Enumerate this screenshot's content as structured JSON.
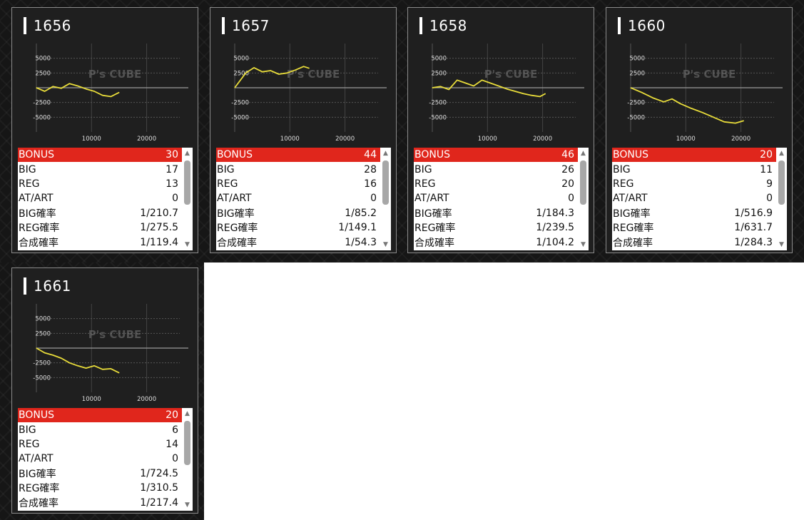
{
  "theme": {
    "highlight": "#e0261c",
    "line": "#e8dc3a",
    "panel": "#1f1f1f"
  },
  "watermark": "P's CUBE",
  "machines": [
    {
      "id": "1656",
      "chart_data": {
        "type": "line",
        "x": [
          0,
          1500,
          3000,
          4500,
          6000,
          7500,
          9000,
          10500,
          12000,
          13500,
          15000
        ],
        "y": [
          0,
          -600,
          200,
          -100,
          700,
          300,
          -200,
          -600,
          -1300,
          -1500,
          -800
        ],
        "xticks": [
          "10000",
          "20000"
        ],
        "yticks": [
          "5000",
          "2500",
          "-2500",
          "-5000"
        ],
        "xlim": [
          0,
          26000
        ],
        "ylim": [
          -7500,
          7500
        ]
      },
      "stats": [
        {
          "label": "BONUS",
          "value": "30"
        },
        {
          "label": "BIG",
          "value": "17"
        },
        {
          "label": "REG",
          "value": "13"
        },
        {
          "label": "AT/ART",
          "value": "0"
        },
        {
          "label": "BIG確率",
          "value": "1/210.7"
        },
        {
          "label": "REG確率",
          "value": "1/275.5"
        },
        {
          "label": "合成確率",
          "value": "1/119.4"
        }
      ]
    },
    {
      "id": "1657",
      "chart_data": {
        "type": "line",
        "x": [
          0,
          2000,
          3500,
          5000,
          6500,
          8000,
          9500,
          11000,
          12500,
          13500
        ],
        "y": [
          0,
          2500,
          3400,
          2700,
          2900,
          2300,
          2500,
          3000,
          3600,
          3300
        ],
        "xticks": [
          "10000",
          "20000"
        ],
        "yticks": [
          "5000",
          "2500",
          "-2500",
          "-5000"
        ],
        "xlim": [
          0,
          26000
        ],
        "ylim": [
          -7500,
          7500
        ]
      },
      "stats": [
        {
          "label": "BONUS",
          "value": "44"
        },
        {
          "label": "BIG",
          "value": "28"
        },
        {
          "label": "REG",
          "value": "16"
        },
        {
          "label": "AT/ART",
          "value": "0"
        },
        {
          "label": "BIG確率",
          "value": "1/85.2"
        },
        {
          "label": "REG確率",
          "value": "1/149.1"
        },
        {
          "label": "合成確率",
          "value": "1/54.3"
        }
      ]
    },
    {
      "id": "1658",
      "chart_data": {
        "type": "line",
        "x": [
          0,
          1500,
          3000,
          4500,
          6000,
          7500,
          9000,
          10500,
          12000,
          13500,
          15000,
          16500,
          18000,
          19500,
          20500
        ],
        "y": [
          0,
          200,
          -300,
          1300,
          800,
          300,
          1300,
          800,
          300,
          -200,
          -600,
          -1000,
          -1300,
          -1500,
          -1000
        ],
        "xticks": [
          "10000",
          "20000"
        ],
        "yticks": [
          "5000",
          "2500",
          "-2500",
          "-5000"
        ],
        "xlim": [
          0,
          26000
        ],
        "ylim": [
          -7500,
          7500
        ]
      },
      "stats": [
        {
          "label": "BONUS",
          "value": "46"
        },
        {
          "label": "BIG",
          "value": "26"
        },
        {
          "label": "REG",
          "value": "20"
        },
        {
          "label": "AT/ART",
          "value": "0"
        },
        {
          "label": "BIG確率",
          "value": "1/184.3"
        },
        {
          "label": "REG確率",
          "value": "1/239.5"
        },
        {
          "label": "合成確率",
          "value": "1/104.2"
        }
      ]
    },
    {
      "id": "1660",
      "chart_data": {
        "type": "line",
        "x": [
          0,
          2000,
          4000,
          6000,
          7500,
          9000,
          11000,
          13000,
          15000,
          17000,
          19000,
          20500
        ],
        "y": [
          0,
          -800,
          -1700,
          -2400,
          -1900,
          -2700,
          -3500,
          -4200,
          -5000,
          -5800,
          -6000,
          -5600
        ],
        "xticks": [
          "10000",
          "20000"
        ],
        "yticks": [
          "5000",
          "2500",
          "-2500",
          "-5000"
        ],
        "xlim": [
          0,
          26000
        ],
        "ylim": [
          -7500,
          7500
        ]
      },
      "stats": [
        {
          "label": "BONUS",
          "value": "20"
        },
        {
          "label": "BIG",
          "value": "11"
        },
        {
          "label": "REG",
          "value": "9"
        },
        {
          "label": "AT/ART",
          "value": "0"
        },
        {
          "label": "BIG確率",
          "value": "1/516.9"
        },
        {
          "label": "REG確率",
          "value": "1/631.7"
        },
        {
          "label": "合成確率",
          "value": "1/284.3"
        }
      ]
    },
    {
      "id": "1661",
      "chart_data": {
        "type": "line",
        "x": [
          0,
          1500,
          3000,
          4500,
          6000,
          7500,
          9000,
          10500,
          12000,
          13500,
          15000
        ],
        "y": [
          0,
          -800,
          -1200,
          -1700,
          -2500,
          -3000,
          -3400,
          -3000,
          -3600,
          -3500,
          -4200
        ],
        "xticks": [
          "10000",
          "20000"
        ],
        "yticks": [
          "5000",
          "2500",
          "-2500",
          "-5000"
        ],
        "xlim": [
          0,
          26000
        ],
        "ylim": [
          -7500,
          7500
        ]
      },
      "stats": [
        {
          "label": "BONUS",
          "value": "20"
        },
        {
          "label": "BIG",
          "value": "6"
        },
        {
          "label": "REG",
          "value": "14"
        },
        {
          "label": "AT/ART",
          "value": "0"
        },
        {
          "label": "BIG確率",
          "value": "1/724.5"
        },
        {
          "label": "REG確率",
          "value": "1/310.5"
        },
        {
          "label": "合成確率",
          "value": "1/217.4"
        }
      ]
    }
  ]
}
